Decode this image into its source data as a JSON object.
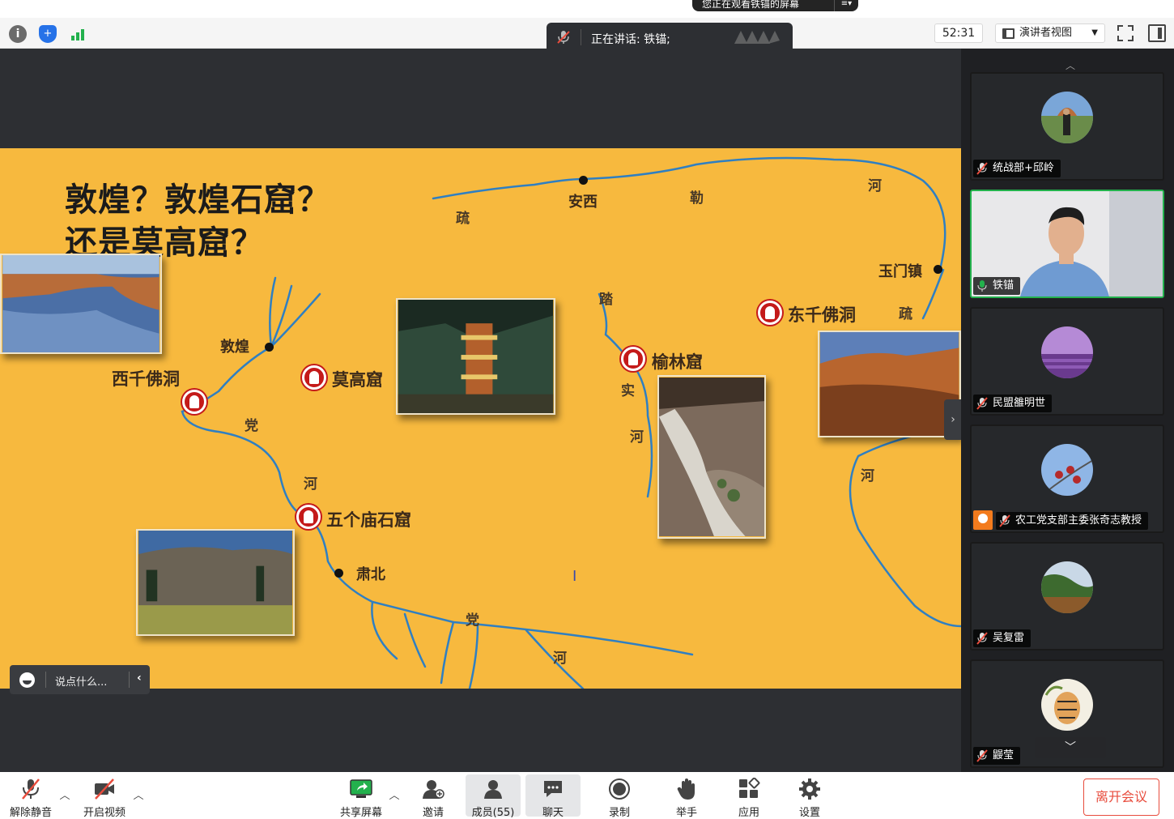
{
  "banner": {
    "share_notice": "您正在观看铁锚的屏幕",
    "share_notice_menu": "≡▾"
  },
  "toolbar": {
    "speaker_text": "正在讲话: 铁锚;",
    "timer": "52:31",
    "view_label": "演讲者视图"
  },
  "slide": {
    "title_line1": "敦煌？敦煌石窟？",
    "title_line2": "还是莫高窟？",
    "sites": [
      "西千佛洞",
      "莫高窟",
      "五个庙石窟",
      "榆林窟",
      "东千佛洞"
    ],
    "towns": [
      "敦煌",
      "安西",
      "玉门镇",
      "肃北"
    ],
    "rivers": [
      "疏",
      "勒",
      "河",
      "党",
      "河",
      "踏",
      "实",
      "河",
      "疏",
      "河",
      "党",
      "河",
      "河"
    ]
  },
  "chat": {
    "placeholder": "说点什么..."
  },
  "participants": [
    {
      "name": "统战部+邱岭",
      "muted": true
    },
    {
      "name": "铁锚",
      "muted": false,
      "speaking": true
    },
    {
      "name": "民盟雒明世",
      "muted": true
    },
    {
      "name": "农工党支部主委张奇志教授",
      "muted": true,
      "host": true
    },
    {
      "name": "吴复雷",
      "muted": true
    },
    {
      "name": "鼹莹",
      "muted": true
    }
  ],
  "bottom_toolbar": {
    "mute": "解除静音",
    "video": "开启视频",
    "share": "共享屏幕",
    "invite": "邀请",
    "members": "成员(55)",
    "chat": "聊天",
    "record": "录制",
    "raise_hand": "举手",
    "apps": "应用",
    "settings": "设置",
    "leave": "离开会议"
  },
  "colors": {
    "accent_green": "#23b14d",
    "leave_red": "#e84c3d",
    "slide_bg": "#f7b93e",
    "river": "#2f7fc2"
  }
}
